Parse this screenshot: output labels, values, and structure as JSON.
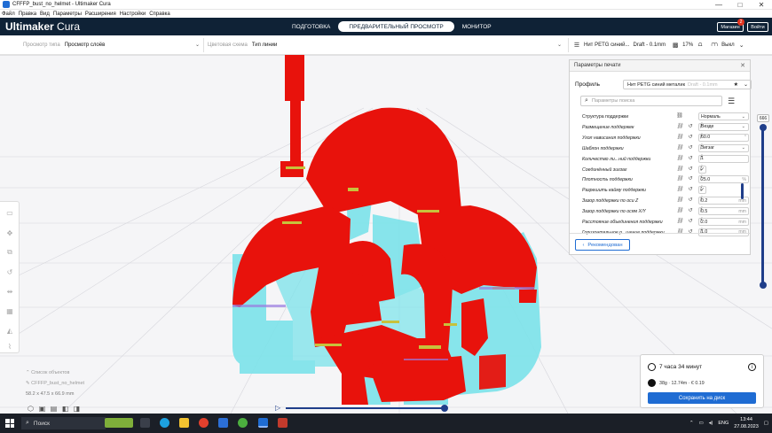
{
  "window": {
    "title": "CFFFP_bust_no_helmet - Ultimaker Cura",
    "controls": [
      "—",
      "□",
      "✕"
    ]
  },
  "menu": [
    "Файл",
    "Правка",
    "Вид",
    "Параметры",
    "Расширения",
    "Настройки",
    "Справка"
  ],
  "header": {
    "brand_bold": "Ultimaker",
    "brand_light": "Cura",
    "stages": [
      {
        "label": "ПОДГОТОВКА",
        "active": false
      },
      {
        "label": "ПРЕДВАРИТЕЛЬНЫЙ ПРОСМОТР",
        "active": true
      },
      {
        "label": "МОНИТОР",
        "active": false
      }
    ],
    "marketplace_label": "Магазин",
    "marketplace_badge": "2",
    "signin_label": "Войти"
  },
  "topbar": {
    "view_type_label": "Просмотр типа",
    "view_type_value": "Просмотр слоёв",
    "color_scheme_label": "Цветовая схема",
    "color_scheme_value": "Тип линии",
    "print_setup": {
      "material": "Нит PETG синий...",
      "profile": "Draft - 0.1mm",
      "infill": "17%",
      "adhesion": "Выкл"
    }
  },
  "settings_panel": {
    "title": "Параметры печати",
    "profile_label": "Профиль",
    "profile_value": "Нит PETG синий металик",
    "profile_suffix": "Draft - 0.1mm",
    "search_placeholder": "Параметры поиска",
    "settings": [
      {
        "label": "Структура поддержки",
        "value": "Нормаль",
        "kind": "select",
        "italic": false
      },
      {
        "label": "Размещение поддержек",
        "value": "Везде",
        "kind": "select",
        "italic": true
      },
      {
        "label": "Угол нависания поддержки",
        "value": "60.0",
        "unit": "°",
        "kind": "input",
        "italic": true
      },
      {
        "label": "Шаблон поддержки",
        "value": "Зигзаг",
        "kind": "select",
        "italic": true
      },
      {
        "label": "Количество ли...ний поддержки",
        "value": "1",
        "kind": "input",
        "italic": true
      },
      {
        "label": "Соединённый зигзаг",
        "value": "✓",
        "kind": "check",
        "italic": true
      },
      {
        "label": "Плотность поддержки",
        "value": "25.0",
        "unit": "%",
        "kind": "input",
        "italic": true
      },
      {
        "label": "Разрешить кайму поддержки",
        "value": "✓",
        "kind": "check",
        "italic": true
      },
      {
        "label": "Зазор поддержки по оси Z",
        "value": "0.2",
        "unit": "mm",
        "kind": "input",
        "italic": true
      },
      {
        "label": "Зазор поддержки по осям X/Y",
        "value": "0.5",
        "unit": "mm",
        "kind": "input",
        "italic": true
      },
      {
        "label": "Расстояние объединения поддержки",
        "value": "2.0",
        "unit": "mm",
        "kind": "input",
        "italic": true
      },
      {
        "label": "Горизонтальное р...шение поддержки",
        "value": "1.0",
        "unit": "mm",
        "kind": "input",
        "italic": true
      }
    ],
    "recommended_label": "Рекомендован"
  },
  "layer_slider": {
    "top_label": "666"
  },
  "objects": {
    "list_label": "Список объектов",
    "object_name": "CFFFP_bust_no_helmet",
    "dimensions": "58.2 x 47.5 x 66.9 mm"
  },
  "estimate": {
    "time": "7 часа 34 минут",
    "material": "38g · 12.74m · € 0.19",
    "save_label": "Сохранить на диск"
  },
  "taskbar": {
    "search": "Поиск",
    "lang": "ENG",
    "time": "13:44",
    "date": "27.08.2023"
  },
  "colors": {
    "header": "#0f2236",
    "accent": "#1f6cd3",
    "model_wall": "#e8120c",
    "support": "#7ce3ea",
    "infill": "#c7c23c"
  }
}
